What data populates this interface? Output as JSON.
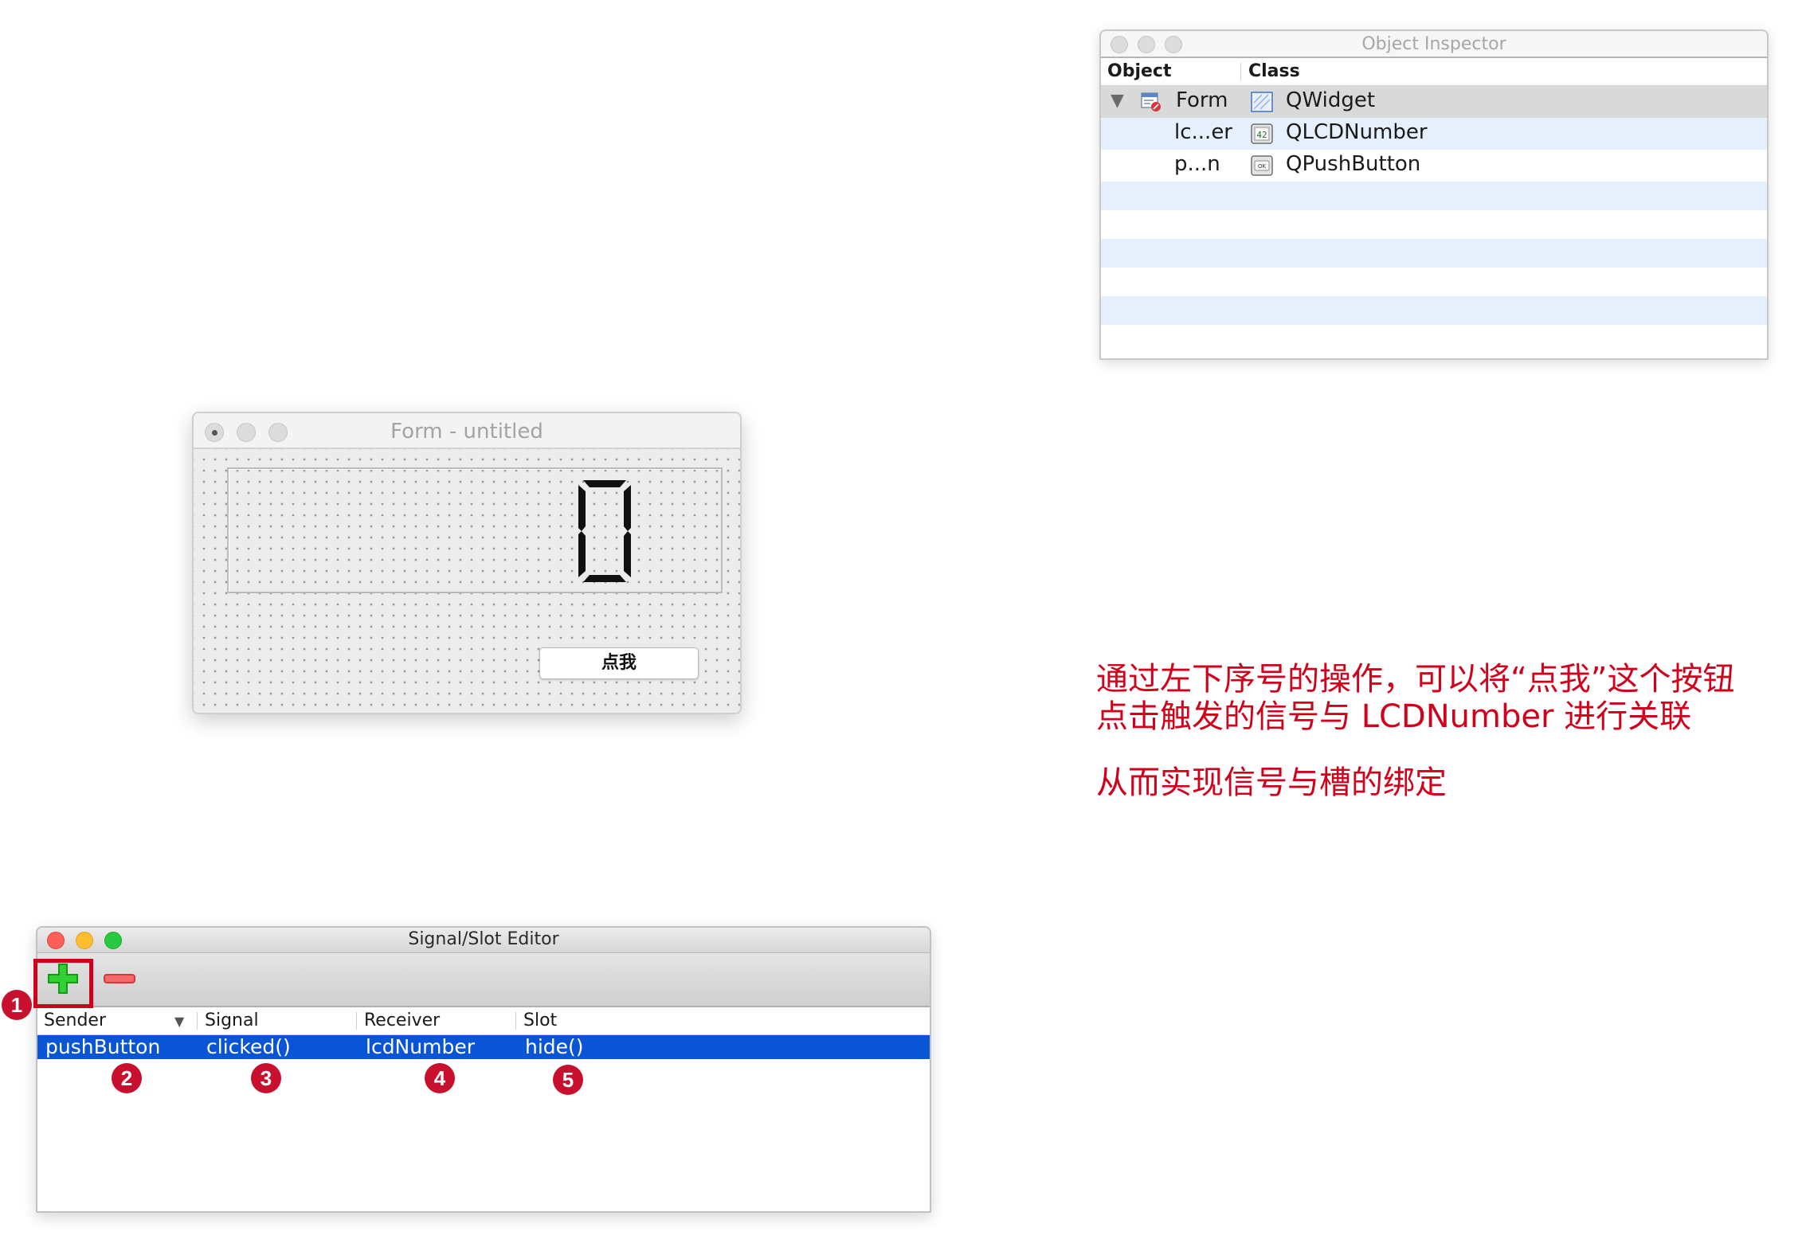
{
  "object_inspector": {
    "title": "Object Inspector",
    "headers": {
      "object": "Object",
      "class": "Class"
    },
    "rows": [
      {
        "object": "Form",
        "class": "QWidget"
      },
      {
        "object": "lc...er",
        "class": "QLCDNumber"
      },
      {
        "object": "p...n",
        "class": "QPushButton"
      }
    ],
    "colors": {
      "selected_row": "#d9d9d9",
      "alt_row": "#e6effc"
    }
  },
  "form_window": {
    "title": "Form - untitled",
    "lcd_value": "0",
    "button_label": "点我"
  },
  "signal_slot_editor": {
    "title": "Signal/Slot Editor",
    "toolbar": {
      "add_icon": "plus-icon",
      "remove_icon": "minus-icon"
    },
    "headers": {
      "sender": "Sender",
      "signal": "Signal",
      "receiver": "Receiver",
      "slot": "Slot"
    },
    "rows": [
      {
        "sender": "pushButton",
        "signal": "clicked()",
        "receiver": "lcdNumber",
        "slot": "hide()"
      }
    ],
    "colors": {
      "selection": "#0a54d6"
    }
  },
  "markers": [
    "1",
    "2",
    "3",
    "4",
    "5"
  ],
  "annotation": {
    "line1": "通过左下序号的操作，可以将“点我”这个按钮",
    "line2": "点击触发的信号与 LCDNumber 进行关联",
    "line3": "从而实现信号与槽的绑定",
    "color": "#d0021b"
  }
}
